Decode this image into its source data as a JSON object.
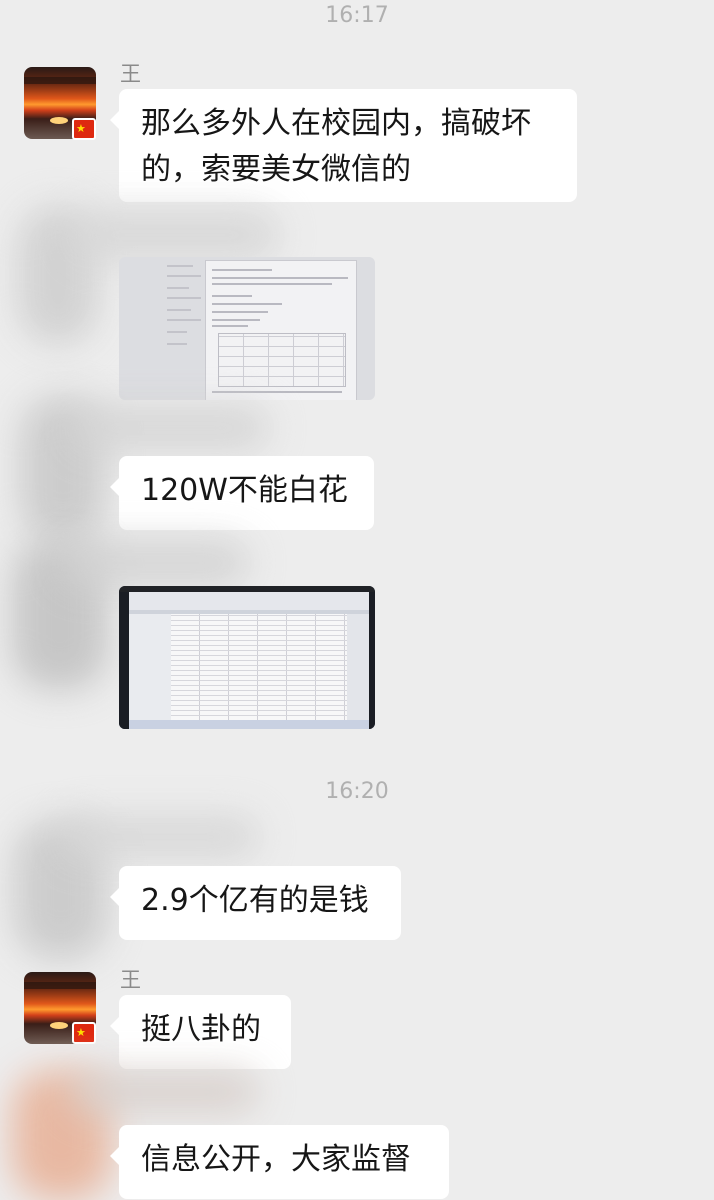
{
  "timestamps": [
    "16:17",
    "16:20"
  ],
  "messages": [
    {
      "sender": "王",
      "text": "那么多外人在校园内，搞破坏的，索要美女微信的"
    },
    {
      "text": "120W不能白花"
    },
    {
      "text": "2.9个亿有的是钱"
    },
    {
      "sender": "王",
      "text": "挺八卦的"
    },
    {
      "text": "信息公开，大家监督"
    }
  ],
  "icons": {
    "avatar": "sunset-avatar",
    "flag": "china-flag-icon"
  },
  "colors": {
    "background": "#ededed",
    "bubble": "#ffffff",
    "timestamp": "#b0b0b0",
    "sender_name": "#8a8a8a"
  }
}
